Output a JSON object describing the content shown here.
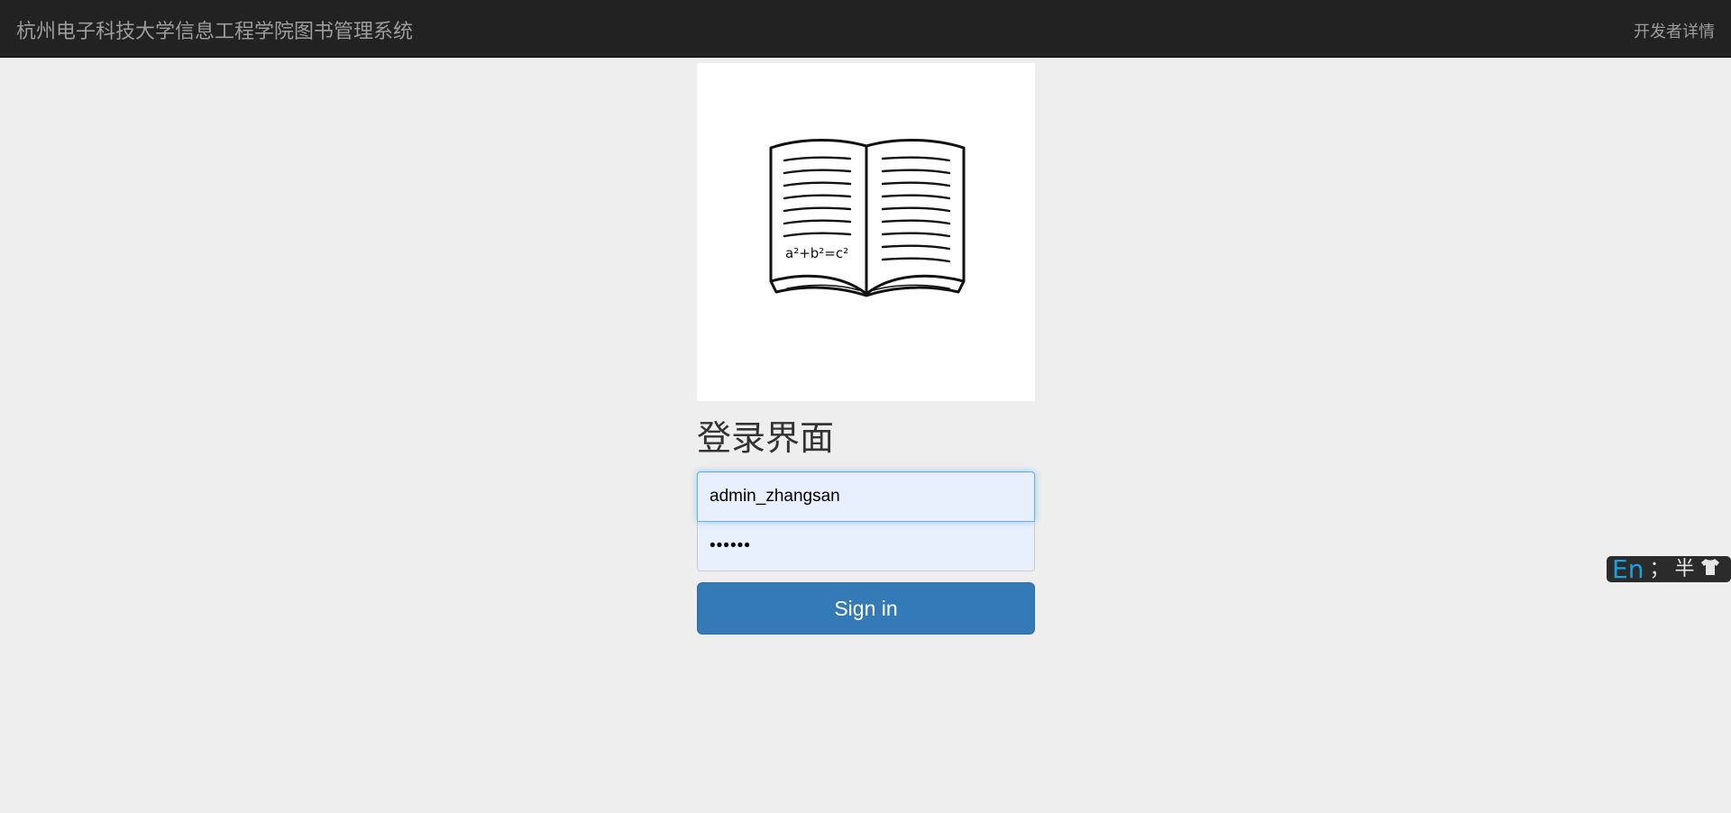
{
  "navbar": {
    "brand": "杭州电子科技大学信息工程学院图书管理系统",
    "developer_link": "开发者详情"
  },
  "login": {
    "heading": "登录界面",
    "username_value": "admin_zhangsan",
    "password_value": "••••••",
    "signin_label": "Sign in"
  },
  "logo": {
    "formula": "a²+b²=c²",
    "icon": "open-book-icon"
  },
  "ime_toolbar": {
    "mode": "En",
    "punct": "；",
    "width_mode": "半",
    "skin_icon": "tshirt-icon"
  },
  "colors": {
    "navbar_bg": "#222222",
    "page_bg": "#eeeeee",
    "button_bg": "#337ab7",
    "ime_accent": "#1ca0e0"
  }
}
